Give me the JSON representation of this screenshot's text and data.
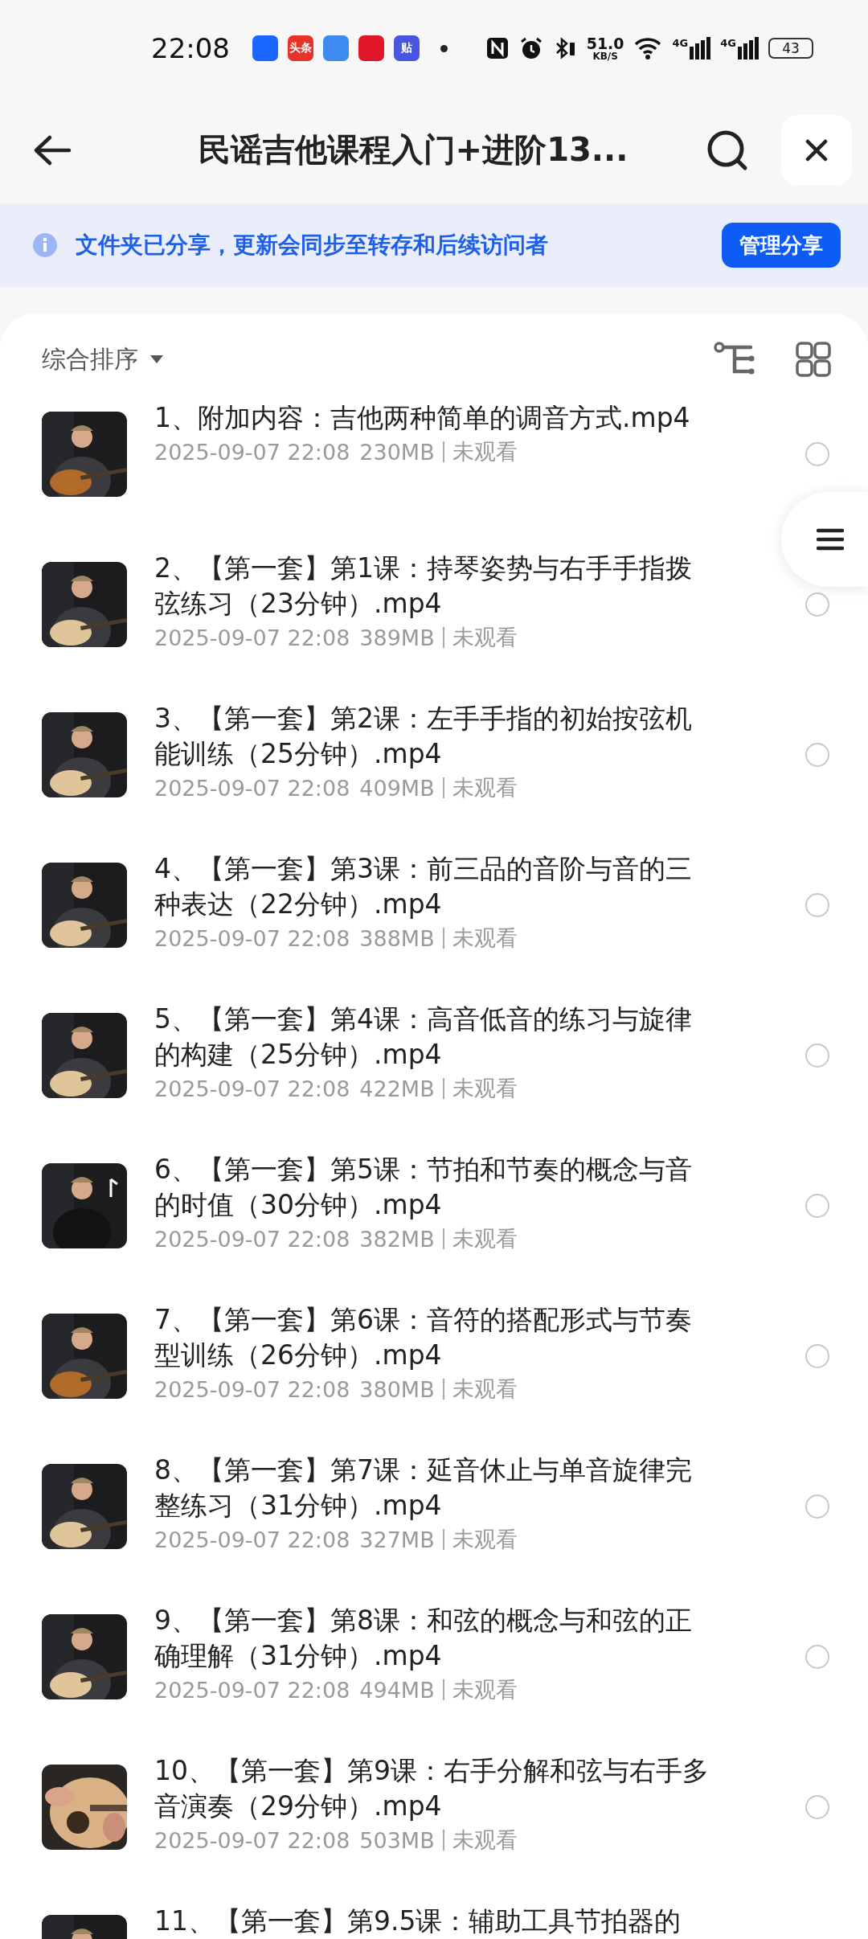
{
  "status_bar": {
    "time": "22:08",
    "notification_icons": [
      {
        "color": "#1a66ff"
      },
      {
        "label": "头条",
        "color": "#e8332a"
      },
      {
        "color": "#3d8bf2"
      },
      {
        "color": "#e0182a"
      },
      {
        "label": "贴",
        "color": "#4a56e0"
      }
    ],
    "net_speed": "51.0",
    "net_unit": "KB/S",
    "signal_1": "4G",
    "signal_2": "4G",
    "battery": "43"
  },
  "header": {
    "title": "民谣吉他课程入门+进阶13..."
  },
  "banner": {
    "text": "文件夹已分享，更新会同步至转存和后续访问者",
    "button": "管理分享"
  },
  "toolbar": {
    "sort": "综合排序"
  },
  "files": [
    {
      "title": "1、附加内容：吉他两种简单的调音方式.mp4",
      "date": "2025-09-07 22:08",
      "size": "230MB",
      "status": "未观看",
      "selected": false
    },
    {
      "title": "2、【第一套】第1课：持琴姿势与右手手指拨弦练习（23分钟）.mp4",
      "date": "2025-09-07 22:08",
      "size": "389MB",
      "status": "未观看",
      "selected": false
    },
    {
      "title": "3、【第一套】第2课：左手手指的初始按弦机能训练（25分钟）.mp4",
      "date": "2025-09-07 22:08",
      "size": "409MB",
      "status": "未观看",
      "selected": false
    },
    {
      "title": "4、【第一套】第3课：前三品的音阶与音的三种表达（22分钟）.mp4",
      "date": "2025-09-07 22:08",
      "size": "388MB",
      "status": "未观看",
      "selected": false
    },
    {
      "title": "5、【第一套】第4课：高音低音的练习与旋律的构建（25分钟）.mp4",
      "date": "2025-09-07 22:08",
      "size": "422MB",
      "status": "未观看",
      "selected": false
    },
    {
      "title": "6、【第一套】第5课：节拍和节奏的概念与音的时值（30分钟）.mp4",
      "date": "2025-09-07 22:08",
      "size": "382MB",
      "status": "未观看",
      "selected": false
    },
    {
      "title": "7、【第一套】第6课：音符的搭配形式与节奏型训练（26分钟）.mp4",
      "date": "2025-09-07 22:08",
      "size": "380MB",
      "status": "未观看",
      "selected": false
    },
    {
      "title": "8、【第一套】第7课：延音休止与单音旋律完整练习（31分钟）.mp4",
      "date": "2025-09-07 22:08",
      "size": "327MB",
      "status": "未观看",
      "selected": false
    },
    {
      "title": "9、【第一套】第8课：和弦的概念与和弦的正确理解（31分钟）.mp4",
      "date": "2025-09-07 22:08",
      "size": "494MB",
      "status": "未观看",
      "selected": false
    },
    {
      "title": "10、【第一套】第9课：右手分解和弦与右手多音演奏（29分钟）.mp4",
      "date": "2025-09-07 22:08",
      "size": "503MB",
      "status": "未观看",
      "selected": false
    },
    {
      "title": "11、【第一套】第9.5课：辅助工具节拍器的"
    }
  ]
}
